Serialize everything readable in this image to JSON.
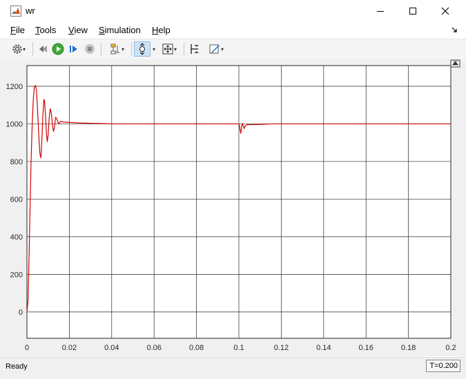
{
  "window": {
    "title": "wr"
  },
  "icons": {
    "app": "matlab-logo-icon",
    "minimize": "minimize-icon",
    "maximize": "maximize-icon",
    "close": "close-icon"
  },
  "menu": {
    "items": [
      {
        "label": "File",
        "mnemonic": "F",
        "rest": "ile"
      },
      {
        "label": "Tools",
        "mnemonic": "T",
        "rest": "ools"
      },
      {
        "label": "View",
        "mnemonic": "V",
        "rest": "iew"
      },
      {
        "label": "Simulation",
        "mnemonic": "S",
        "rest": "imulation"
      },
      {
        "label": "Help",
        "mnemonic": "H",
        "rest": "elp"
      }
    ]
  },
  "toolbar": {
    "buttons": [
      {
        "name": "settings",
        "icon": "gear-icon"
      },
      {
        "name": "step-back",
        "icon": "step-back-icon"
      },
      {
        "name": "run",
        "icon": "play-icon"
      },
      {
        "name": "step-forward",
        "icon": "step-forward-icon"
      },
      {
        "name": "stop",
        "icon": "stop-icon"
      },
      {
        "name": "highlight-model",
        "icon": "model-highlight-icon"
      },
      {
        "name": "zoom",
        "icon": "zoom-icon",
        "active": true
      },
      {
        "name": "autoscale",
        "icon": "autoscale-icon"
      },
      {
        "name": "cursor-measure",
        "icon": "cursor-measure-icon"
      },
      {
        "name": "style",
        "icon": "style-icon"
      }
    ]
  },
  "status": {
    "text": "Ready",
    "time": "T=0.200"
  },
  "chart_data": {
    "type": "line",
    "title": "",
    "xlabel": "",
    "ylabel": "",
    "xlim": [
      0,
      0.2
    ],
    "ylim": [
      -140,
      1310
    ],
    "xticks": [
      "0",
      "0.02",
      "0.04",
      "0.06",
      "0.08",
      "0.1",
      "0.12",
      "0.14",
      "0.16",
      "0.18",
      "0.2"
    ],
    "yticks": [
      "0",
      "200",
      "400",
      "600",
      "800",
      "1000",
      "1200"
    ],
    "grid": true,
    "background": "#ffffff",
    "grid_color": "#262626",
    "series": [
      {
        "color": "#d00000",
        "points": [
          [
            0,
            0
          ],
          [
            0.0005,
            60
          ],
          [
            0.001,
            290
          ],
          [
            0.0015,
            560
          ],
          [
            0.002,
            820
          ],
          [
            0.0025,
            1000
          ],
          [
            0.003,
            1130
          ],
          [
            0.0035,
            1195
          ],
          [
            0.004,
            1205
          ],
          [
            0.0045,
            1180
          ],
          [
            0.005,
            1080
          ],
          [
            0.0055,
            960
          ],
          [
            0.006,
            860
          ],
          [
            0.0062,
            835
          ],
          [
            0.0066,
            820
          ],
          [
            0.007,
            900
          ],
          [
            0.0075,
            1040
          ],
          [
            0.008,
            1130
          ],
          [
            0.0083,
            1122
          ],
          [
            0.0088,
            1040
          ],
          [
            0.0092,
            950
          ],
          [
            0.0096,
            905
          ],
          [
            0.01,
            940
          ],
          [
            0.0105,
            1030
          ],
          [
            0.011,
            1080
          ],
          [
            0.0115,
            1060
          ],
          [
            0.012,
            1000
          ],
          [
            0.0125,
            960
          ],
          [
            0.013,
            980
          ],
          [
            0.0135,
            1035
          ],
          [
            0.014,
            1030
          ],
          [
            0.015,
            1000
          ],
          [
            0.016,
            1014
          ],
          [
            0.017,
            1010
          ],
          [
            0.02,
            1008
          ],
          [
            0.025,
            1005
          ],
          [
            0.03,
            1003
          ],
          [
            0.035,
            1002
          ],
          [
            0.038,
            1001
          ],
          [
            0.04,
            1000
          ],
          [
            0.1,
            1000
          ],
          [
            0.1003,
            990
          ],
          [
            0.1006,
            965
          ],
          [
            0.1009,
            950
          ],
          [
            0.1013,
            985
          ],
          [
            0.1017,
            1003
          ],
          [
            0.102,
            990
          ],
          [
            0.1025,
            975
          ],
          [
            0.103,
            990
          ],
          [
            0.104,
            996
          ],
          [
            0.11,
            997
          ],
          [
            0.113,
            999
          ],
          [
            0.115,
            1000
          ],
          [
            0.2,
            1000
          ]
        ]
      }
    ]
  }
}
